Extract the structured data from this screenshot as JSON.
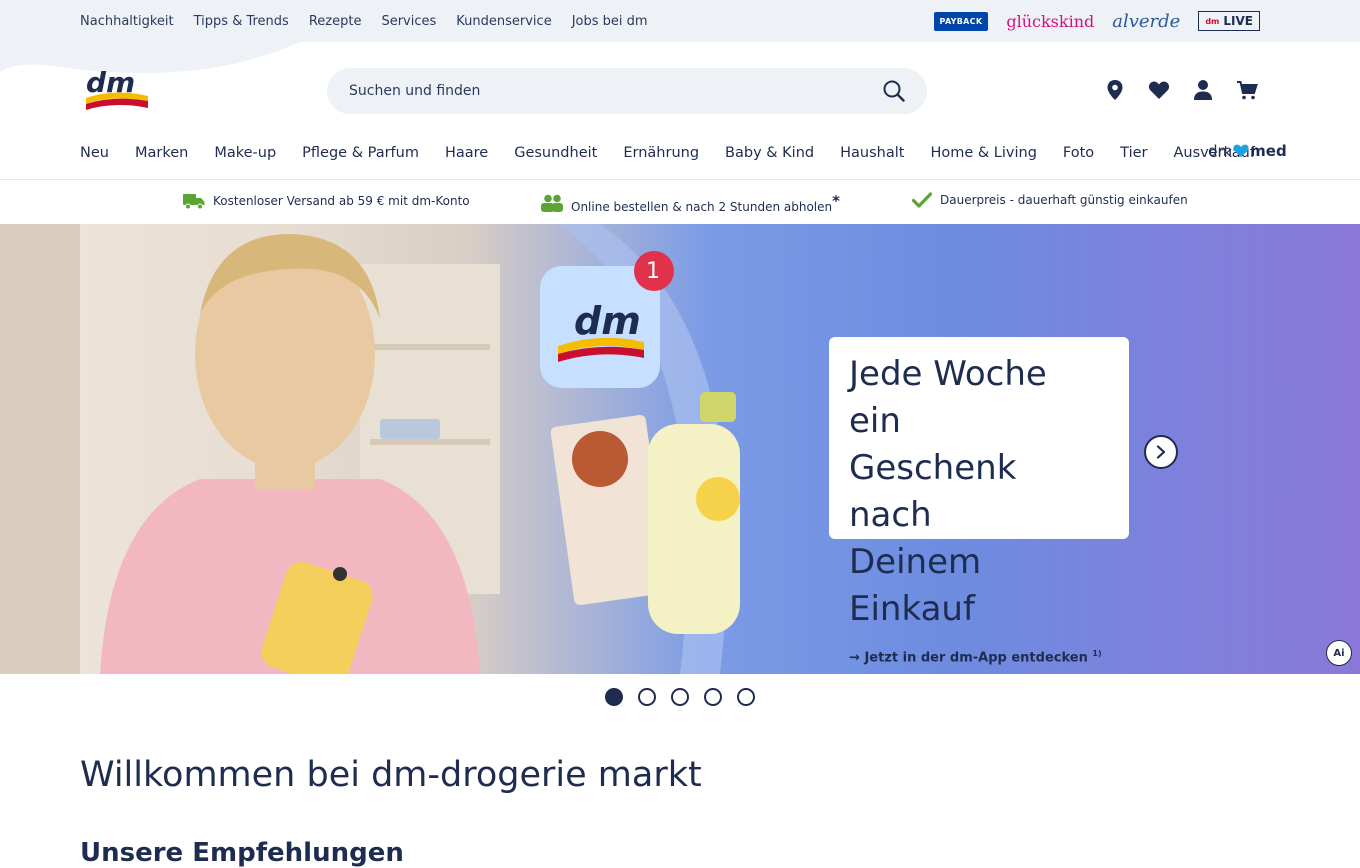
{
  "topbar": {
    "links": [
      "Nachhaltigkeit",
      "Tipps & Trends",
      "Rezepte",
      "Services",
      "Kundenservice",
      "Jobs bei dm"
    ],
    "payback": "PAYBACK",
    "glueckskind": "glückskind",
    "alverde": "alverde",
    "live": "LIVE",
    "live_prefix": "dm"
  },
  "header": {
    "logo_text": "dm",
    "search_placeholder": "Suchen und finden",
    "icons": [
      "location-icon",
      "heart-icon",
      "user-icon",
      "cart-icon"
    ]
  },
  "catnav": {
    "items": [
      "Neu",
      "Marken",
      "Make-up",
      "Pflege & Parfum",
      "Haare",
      "Gesundheit",
      "Ernährung",
      "Baby & Kind",
      "Haushalt",
      "Home & Living",
      "Foto",
      "Tier",
      "Ausverkauf"
    ],
    "dmmed_prefix": "dm",
    "dmmed_suffix": "med"
  },
  "usps": [
    {
      "icon": "truck-icon",
      "text": "Kostenloser Versand ab 59 € mit dm-Konto"
    },
    {
      "icon": "people-icon",
      "text": "Online bestellen & nach 2 Stunden abholen",
      "suffix": "*"
    },
    {
      "icon": "check-icon",
      "text": "Dauerpreis - dauerhaft günstig einkaufen"
    }
  ],
  "hero": {
    "title_lines": [
      "Jede Woche ein",
      "Geschenk nach",
      "Deinem Einkauf"
    ],
    "cta": "Jetzt in der dm-App entdecken",
    "cta_note": "1)",
    "app_badge": "1",
    "ai_badge": "Ai",
    "slide_count": 5,
    "active_slide": 1
  },
  "welcome": "Willkommen bei dm-drogerie markt",
  "subheading": "Unsere Empfehlungen",
  "colors": {
    "navy": "#1e2c4f",
    "dm_red": "#c8102e",
    "dm_yellow": "#f6bc00",
    "usp_green": "#5aa532"
  }
}
